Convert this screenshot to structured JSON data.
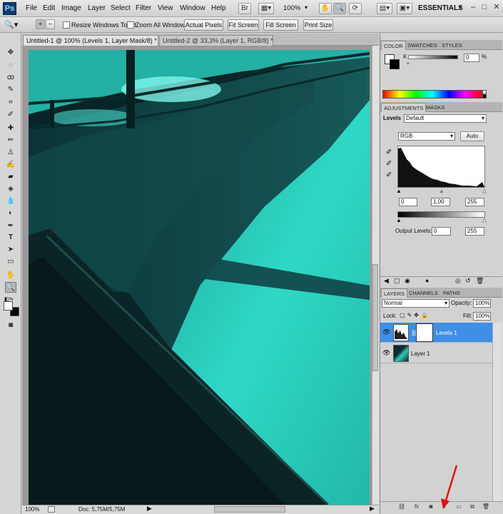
{
  "app": {
    "logo": "Ps",
    "workspace": "ESSENTIALS",
    "zoom": "100%"
  },
  "menu": [
    "File",
    "Edit",
    "Image",
    "Layer",
    "Select",
    "Filter",
    "View",
    "Window",
    "Help"
  ],
  "options": {
    "resize_windows": "Resize Windows To Fit",
    "zoom_all": "Zoom All Windows",
    "actual_pixels": "Actual Pixels",
    "fit_screen": "Fit Screen",
    "fill_screen": "Fill Screen",
    "print_size": "Print Size"
  },
  "doc_tabs": [
    {
      "label": "Untitled-1 @ 100% (Levels 1, Layer Mask/8) *"
    },
    {
      "label": "Untitled-2 @ 33,3% (Layer 1, RGB/8) *"
    }
  ],
  "status": {
    "zoom": "100%",
    "doc": "Doc: 5,75M/5,75M"
  },
  "color_panel": {
    "tabs": [
      "COLOR",
      "SWATCHES",
      "STYLES"
    ],
    "channel": "K",
    "value": "0",
    "unit": "%"
  },
  "adjustments": {
    "tabs": [
      "ADJUSTMENTS",
      "MASKS"
    ],
    "title": "Levels",
    "preset": "Default",
    "channel": "RGB",
    "auto": "Auto",
    "input": [
      "0",
      "1,00",
      "255"
    ],
    "output_label": "Output Levels:",
    "output": [
      "0",
      "255"
    ]
  },
  "layers_panel": {
    "tabs": [
      "LAYERS",
      "CHANNELS",
      "PATHS"
    ],
    "blend": "Normal",
    "opacity_label": "Opacity:",
    "opacity": "100%",
    "lock_label": "Lock:",
    "fill_label": "Fill:",
    "fill": "100%",
    "layers": [
      {
        "name": "Levels 1"
      },
      {
        "name": "Layer 1"
      }
    ]
  },
  "colors": {
    "accent": "#2f7fd6",
    "selected_layer": "#3f8fe6",
    "photo_teal": "#2bd6c4",
    "annotation_arrow": "#e01010"
  }
}
